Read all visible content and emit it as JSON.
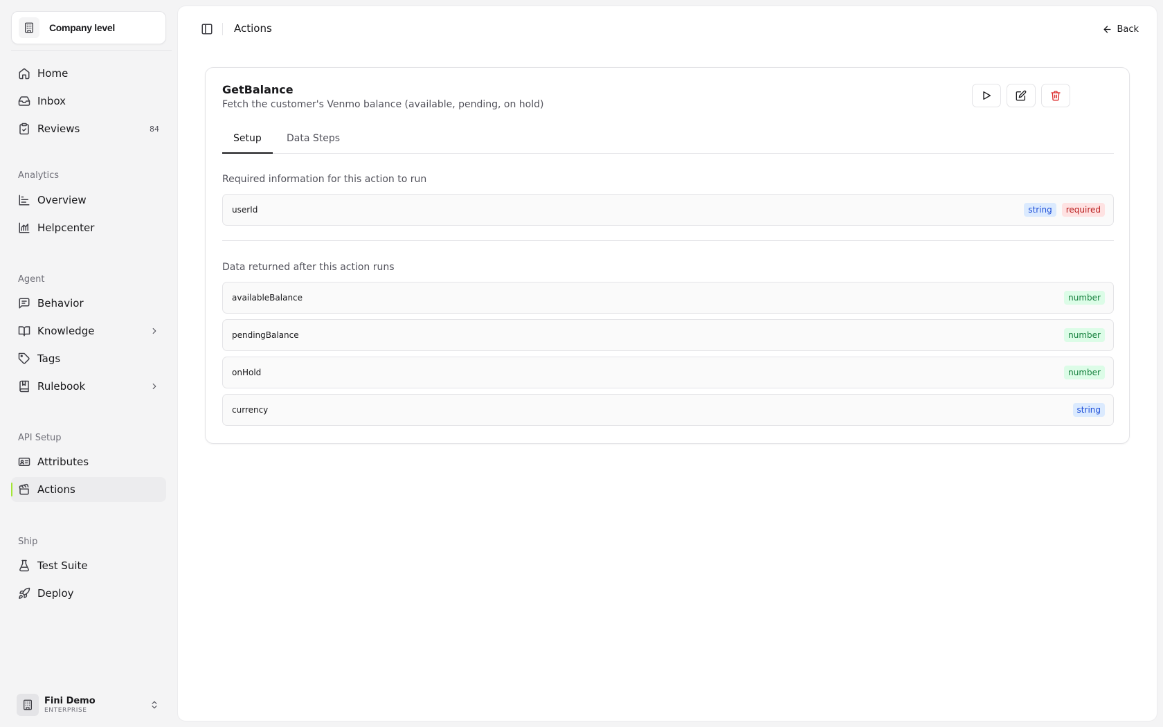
{
  "sidebar": {
    "company_label": "Company level",
    "nav_main": [
      {
        "label": "Home",
        "icon": "home-icon"
      },
      {
        "label": "Inbox",
        "icon": "inbox-icon"
      },
      {
        "label": "Reviews",
        "icon": "clipboard-check-icon",
        "badge": "84"
      }
    ],
    "analytics": {
      "label": "Analytics",
      "items": [
        {
          "label": "Overview",
          "icon": "bar-chart-icon"
        },
        {
          "label": "Helpcenter",
          "icon": "line-chart-icon"
        }
      ]
    },
    "agent": {
      "label": "Agent",
      "items": [
        {
          "label": "Behavior",
          "icon": "message-square-icon"
        },
        {
          "label": "Knowledge",
          "icon": "book-open-icon"
        },
        {
          "label": "Tags",
          "icon": "tag-icon"
        },
        {
          "label": "Rulebook",
          "icon": "notebook-icon"
        }
      ]
    },
    "api_setup": {
      "label": "API Setup",
      "items": [
        {
          "label": "Attributes",
          "icon": "id-card-icon"
        },
        {
          "label": "Actions",
          "icon": "clapperboard-icon",
          "active": true
        }
      ]
    },
    "ship": {
      "label": "Ship",
      "items": [
        {
          "label": "Test Suite",
          "icon": "flask-icon"
        },
        {
          "label": "Deploy",
          "icon": "rocket-icon"
        }
      ]
    },
    "user": {
      "name": "Fini Demo",
      "plan": "ENTERPRISE"
    }
  },
  "topbar": {
    "title": "Actions",
    "back_label": "Back"
  },
  "action": {
    "name": "GetBalance",
    "description": "Fetch the customer's Venmo balance (available, pending, on hold)",
    "tabs": [
      "Setup",
      "Data Steps"
    ],
    "active_tab": "Setup",
    "inputs_heading": "Required information for this action to run",
    "inputs": [
      {
        "name": "userId",
        "type": "string",
        "required_label": "required"
      }
    ],
    "outputs_heading": "Data returned after this action runs",
    "outputs": [
      {
        "name": "availableBalance",
        "type": "number"
      },
      {
        "name": "pendingBalance",
        "type": "number"
      },
      {
        "name": "onHold",
        "type": "number"
      },
      {
        "name": "currency",
        "type": "string"
      }
    ]
  },
  "colors": {
    "accent": "#a3e635",
    "danger": "#dc2626",
    "string_tag": "#1d4ed8",
    "number_tag": "#15803d"
  }
}
